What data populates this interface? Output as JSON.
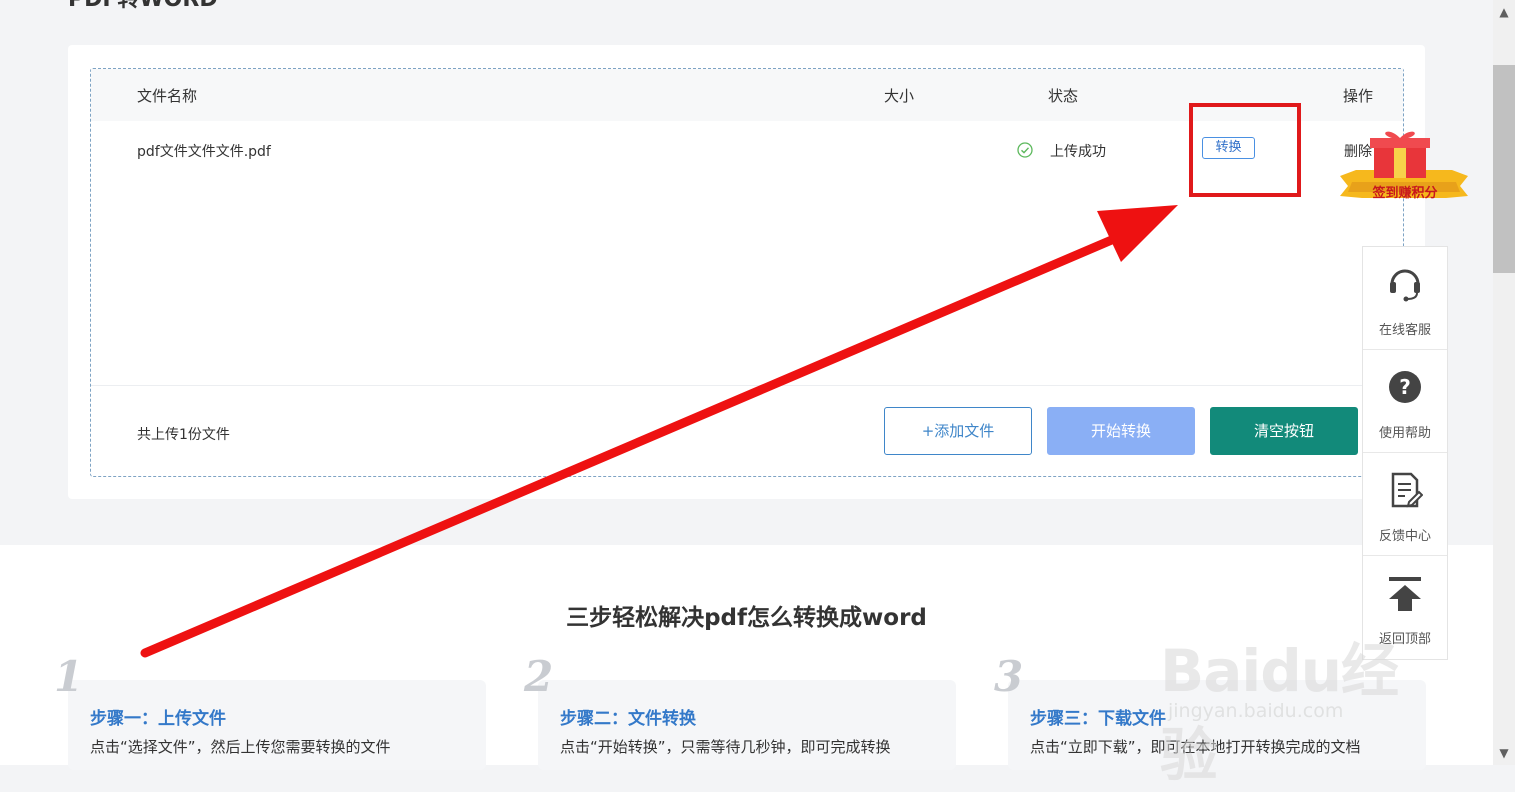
{
  "page_title": "PDF转WORD",
  "table": {
    "headers": {
      "name": "文件名称",
      "size": "大小",
      "status": "状态",
      "action": "操作"
    },
    "rows": [
      {
        "name": "pdf文件文件文件.pdf",
        "size": "",
        "status": "上传成功",
        "convert_label": "转换",
        "delete_label": "删除"
      }
    ]
  },
  "footer": {
    "count_text": "共上传1份文件",
    "add_label": "+添加文件",
    "start_label": "开始转换",
    "clear_label": "清空按钮"
  },
  "reward_badge": "签到赚积分",
  "side_panel": {
    "items": [
      {
        "label": "在线客服",
        "icon": "headset-icon"
      },
      {
        "label": "使用帮助",
        "icon": "question-icon"
      },
      {
        "label": "反馈中心",
        "icon": "feedback-icon"
      },
      {
        "label": "返回顶部",
        "icon": "back-to-top-icon"
      }
    ]
  },
  "section": {
    "title": "三步轻松解决pdf怎么转换成word",
    "steps": [
      {
        "num": "1",
        "title": "步骤一：上传文件",
        "desc": "点击“选择文件”，然后上传您需要转换的文件"
      },
      {
        "num": "2",
        "title": "步骤二：文件转换",
        "desc": "点击“开始转换”，只需等待几秒钟，即可完成转换"
      },
      {
        "num": "3",
        "title": "步骤三：下载文件",
        "desc": "点击“立即下载”，即可在本地打开转换完成的文档"
      }
    ]
  },
  "watermark": {
    "brand": "Baidu经验",
    "url": "jingyan.baidu.com"
  },
  "colors": {
    "accent_blue": "#3479c9",
    "primary_teal": "#128a7a",
    "start_button": "#8aaff5",
    "annotation_red": "#e0191b",
    "success_green": "#5cb85c"
  }
}
